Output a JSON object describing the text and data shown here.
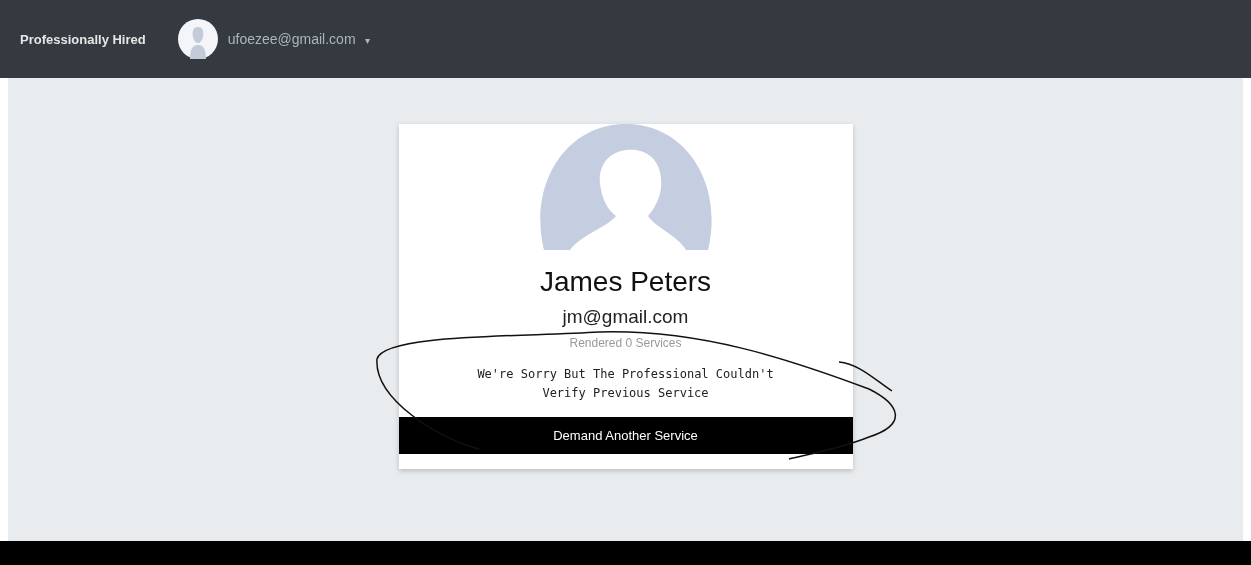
{
  "navbar": {
    "brand": "Professionally Hired",
    "user_email": "ufoezee@gmail.com",
    "caret": "▾"
  },
  "profile_card": {
    "name": "James Peters",
    "email": "jm@gmail.com",
    "services_count": "Rendered 0 Services",
    "message": "We're Sorry But The Professional Couldn't Verify Previous Service",
    "button": "Demand Another Service"
  }
}
